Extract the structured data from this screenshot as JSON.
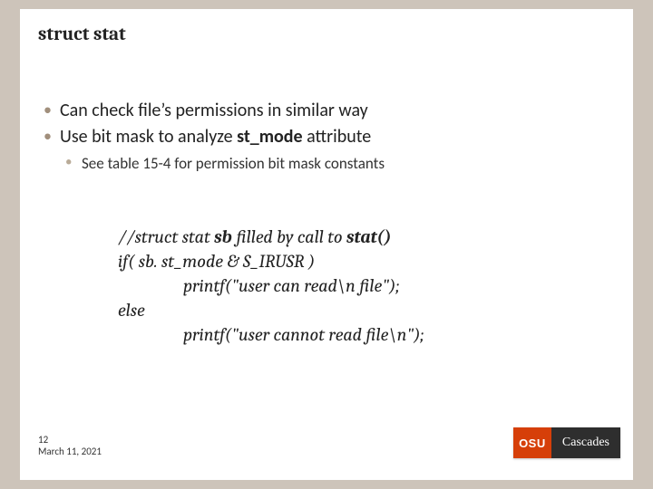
{
  "title": "struct stat",
  "bullets": {
    "b1a": "Can check file’s permissions in similar way",
    "b1b_pre": "Use bit mask to analyze ",
    "b1b_bold": "st_mode",
    "b1b_post": " attribute",
    "b2a": "See table 15-4 for permission bit mask constants"
  },
  "code": {
    "l1_pre": "//struct stat ",
    "l1_b1": "sb",
    "l1_mid": " filled by call to ",
    "l1_b2": "stat()",
    "l2": "if( sb. st_mode & S_IRUSR )",
    "l3": "printf(\"user can read\\n file\");",
    "l4": "else",
    "l5": "printf(\"user cannot read file\\n\");"
  },
  "footer": {
    "page": "12",
    "date": "March 11, 2021"
  },
  "logo": {
    "short": "OSU",
    "name": "Cascades"
  }
}
